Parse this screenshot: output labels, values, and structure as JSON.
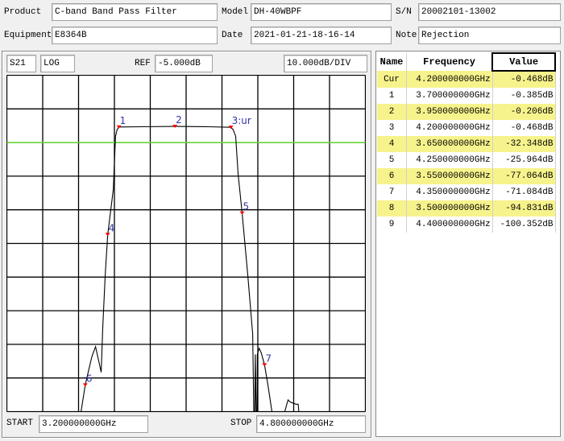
{
  "info": {
    "product_label": "Product",
    "product_value": "C-band Band Pass Filter",
    "model_label": "Model",
    "model_value": "DH-40WBPF",
    "sn_label": "S/N",
    "sn_value": "20002101-13002",
    "equipment_label": "Equipment",
    "equipment_value": "E8364B",
    "date_label": "Date",
    "date_value": "2021-01-21-18-16-14",
    "note_label": "Note",
    "note_value": "Rejection"
  },
  "chart_header": {
    "param": "S21",
    "format": "LOG",
    "ref_label": "REF",
    "ref_value": "-5.000dB",
    "scale": "10.000dB/DIV"
  },
  "chart_footer": {
    "start_label": "START",
    "start_value": "3.200000000GHz",
    "stop_label": "STOP",
    "stop_value": "4.800000000GHz"
  },
  "chart_data": {
    "type": "line",
    "xlim": [
      3.2,
      4.8
    ],
    "ylim": [
      -85,
      15
    ],
    "x_unit": "GHz",
    "y_unit": "dB",
    "ref_level": -5,
    "divisions": {
      "x": 10,
      "y": 10
    },
    "grid": true,
    "colors": {
      "trace": "#000000",
      "grid": "#000000",
      "ref_line": "#66dd33",
      "marker": "#ff0000",
      "marker_label": "#3333aa"
    },
    "trace": [
      [
        3.531,
        -85
      ],
      [
        3.55,
        -77.064
      ],
      [
        3.567,
        -72.1
      ],
      [
        3.58,
        -68.5
      ],
      [
        3.596,
        -65.7
      ],
      [
        3.621,
        -73.3
      ],
      [
        3.628,
        -60.2
      ],
      [
        3.639,
        -44.3
      ],
      [
        3.65,
        -32.348
      ],
      [
        3.675,
        -19
      ],
      [
        3.685,
        -3.1
      ],
      [
        3.692,
        -1.2
      ],
      [
        3.7,
        -0.385
      ],
      [
        3.8,
        -0.3
      ],
      [
        3.95,
        -0.206
      ],
      [
        4.1,
        -0.3
      ],
      [
        4.2,
        -0.468
      ],
      [
        4.21,
        -1.2
      ],
      [
        4.221,
        -3.1
      ],
      [
        4.232,
        -14.3
      ],
      [
        4.25,
        -25.964
      ],
      [
        4.275,
        -44.3
      ],
      [
        4.297,
        -61.9
      ],
      [
        4.302,
        -85
      ],
      [
        4.306,
        -85
      ],
      [
        4.309,
        -68
      ],
      [
        4.312,
        -85
      ],
      [
        4.316,
        -85
      ],
      [
        4.318,
        -68
      ],
      [
        4.326,
        -66.2
      ],
      [
        4.335,
        -67.5
      ],
      [
        4.35,
        -71.084
      ],
      [
        4.365,
        -77
      ],
      [
        4.383,
        -85
      ],
      [
        4.44,
        -85
      ],
      [
        4.45,
        -82.6
      ],
      [
        4.455,
        -81.5
      ],
      [
        4.462,
        -82
      ],
      [
        4.47,
        -82.3
      ],
      [
        4.48,
        -82.5
      ],
      [
        4.49,
        -82.8
      ],
      [
        4.5,
        -82.8
      ],
      [
        4.503,
        -85
      ]
    ],
    "markers": [
      {
        "label": "1",
        "freq": 3.7,
        "value": -0.385
      },
      {
        "label": "2",
        "freq": 3.95,
        "value": -0.206
      },
      {
        "label": "3:ur",
        "freq": 4.2,
        "value": -0.468
      },
      {
        "label": "4",
        "freq": 3.65,
        "value": -32.348
      },
      {
        "label": "5",
        "freq": 4.25,
        "value": -25.964
      },
      {
        "label": "6",
        "freq": 3.55,
        "value": -77.064
      },
      {
        "label": "7",
        "freq": 4.35,
        "value": -71.084
      }
    ]
  },
  "marker_table": {
    "headers": [
      "Name",
      "Frequency",
      "Value"
    ],
    "rows": [
      {
        "name": "Cur",
        "freq": "4.200000000GHz",
        "value": "-0.468dB",
        "highlight": true
      },
      {
        "name": "1",
        "freq": "3.700000000GHz",
        "value": "-0.385dB",
        "highlight": false
      },
      {
        "name": "2",
        "freq": "3.950000000GHz",
        "value": "-0.206dB",
        "highlight": true
      },
      {
        "name": "3",
        "freq": "4.200000000GHz",
        "value": "-0.468dB",
        "highlight": false
      },
      {
        "name": "4",
        "freq": "3.650000000GHz",
        "value": "-32.348dB",
        "highlight": true
      },
      {
        "name": "5",
        "freq": "4.250000000GHz",
        "value": "-25.964dB",
        "highlight": false
      },
      {
        "name": "6",
        "freq": "3.550000000GHz",
        "value": "-77.064dB",
        "highlight": true
      },
      {
        "name": "7",
        "freq": "4.350000000GHz",
        "value": "-71.084dB",
        "highlight": false
      },
      {
        "name": "8",
        "freq": "3.500000000GHz",
        "value": "-94.831dB",
        "highlight": true
      },
      {
        "name": "9",
        "freq": "4.400000000GHz",
        "value": "-100.352dB",
        "highlight": false
      }
    ],
    "highlight_color": "#f7f38c"
  }
}
